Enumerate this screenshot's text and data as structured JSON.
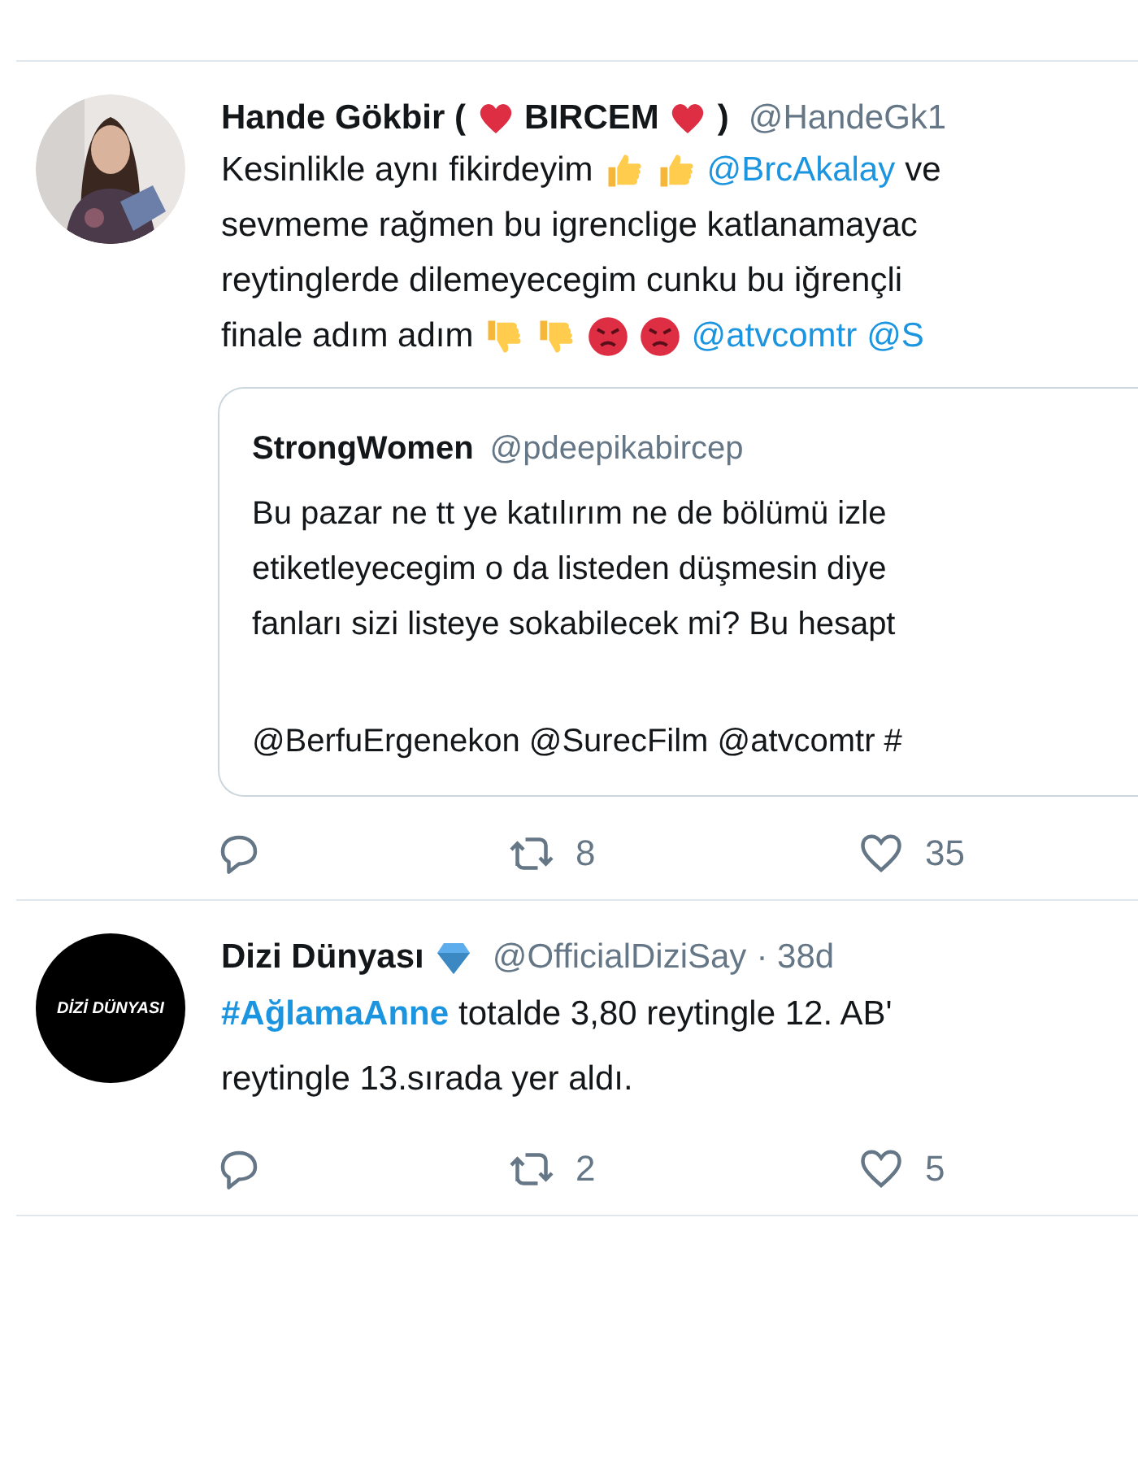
{
  "tweets": [
    {
      "avatar": {
        "kind": "picture"
      },
      "name": [
        {
          "kind": "text",
          "text": "Hande Gökbir ("
        },
        {
          "kind": "heart"
        },
        {
          "kind": "text",
          "text": "BIRCEM"
        },
        {
          "kind": "heart"
        },
        {
          "kind": "text",
          "text": ")"
        }
      ],
      "handle": "@HandeGk1",
      "lines": [
        [
          {
            "kind": "text",
            "text": "Kesinlikle aynı fikirdeyim"
          },
          {
            "kind": "thumbs-up"
          },
          {
            "kind": "thumbs-up"
          },
          {
            "kind": "mention",
            "text": "@BrcAkalay"
          },
          {
            "kind": "text",
            "text": "ve"
          }
        ],
        [
          {
            "kind": "text",
            "text": "sevmeme rağmen bu igrenclige katlanamayac"
          }
        ],
        [
          {
            "kind": "text",
            "text": "reytinglerde dilemeyecegim cunku bu iğrençli"
          }
        ],
        [
          {
            "kind": "text",
            "text": "finale adım adım"
          },
          {
            "kind": "thumbs-down"
          },
          {
            "kind": "thumbs-down"
          },
          {
            "kind": "angry-face"
          },
          {
            "kind": "angry-face"
          },
          {
            "kind": "mention",
            "text": "@atvcomtr"
          },
          {
            "kind": "mention",
            "text": "@S"
          }
        ]
      ],
      "quote": {
        "name": "StrongWomen",
        "handle": "@pdeepikabircep",
        "paragraphs": [
          [
            "Bu pazar ne tt ye katılırım ne de bölümü izle",
            "etiketleyecegim o da listeden düşmesin diye",
            "fanları sizi listeye sokabilecek mi? Bu hesapt"
          ],
          [
            "@BerfuErgenekon @SurecFilm @atvcomtr #"
          ]
        ]
      },
      "retweets": "8",
      "likes": "35"
    },
    {
      "avatar": {
        "kind": "logo",
        "text": "DİZİ DÜNYASI"
      },
      "name": [
        {
          "kind": "text",
          "text": "Dizi Dünyası"
        },
        {
          "kind": "gem"
        }
      ],
      "handle": "@OfficialDiziSay",
      "time": "· 38d",
      "lines": [
        [
          {
            "kind": "hashtag",
            "text": "#AğlamaAnne"
          },
          {
            "kind": "text",
            "text": "totalde 3,80 reytingle 12. AB'"
          }
        ],
        [
          {
            "kind": "text",
            "text": "reytingle 13.sırada yer aldı."
          }
        ]
      ],
      "retweets": "2",
      "likes": "5"
    }
  ]
}
